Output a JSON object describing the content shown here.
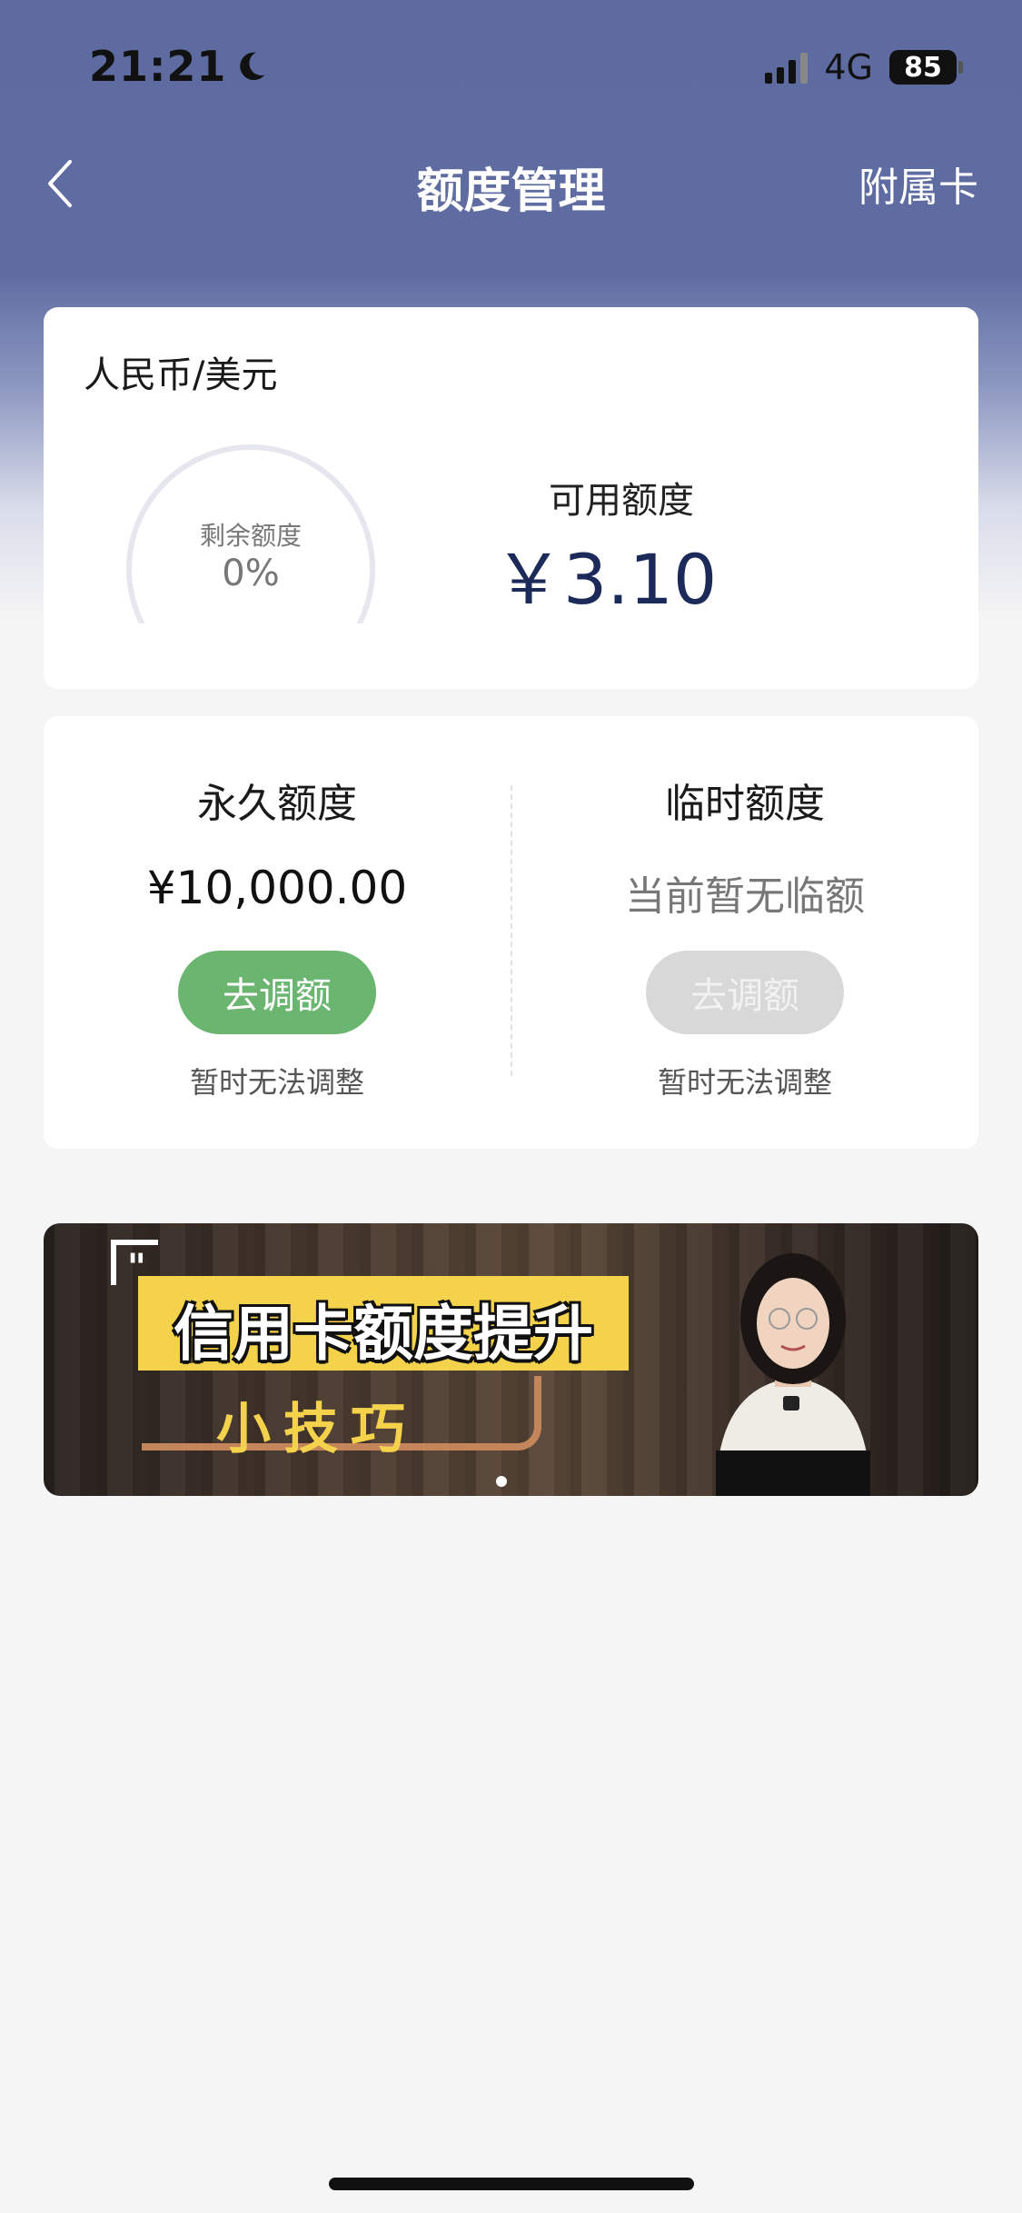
{
  "status_bar": {
    "time": "21:21",
    "network": "4G",
    "battery": "85"
  },
  "nav": {
    "title": "额度管理",
    "right_action": "附属卡"
  },
  "balance_card": {
    "currency": "人民币/美元",
    "gauge_caption": "剩余额度",
    "gauge_value": "0%",
    "remaining_fraction": 0,
    "available_label": "可用额度",
    "available_amount": "￥3.10"
  },
  "limits": {
    "permanent": {
      "title": "永久额度",
      "amount": "¥10,000.00",
      "button": "去调额",
      "note": "暂时无法调整"
    },
    "temporary": {
      "title": "临时额度",
      "amount": "当前暂无临额",
      "button": "去调额",
      "note": "暂时无法调整"
    }
  },
  "banner": {
    "title": "信用卡额度提升",
    "subtitle": "小技巧"
  },
  "colors": {
    "header": "#5d6ba0",
    "accent_green": "#6ab56f",
    "amount_navy": "#1c2a5a",
    "banner_yellow": "#f4d24c"
  }
}
